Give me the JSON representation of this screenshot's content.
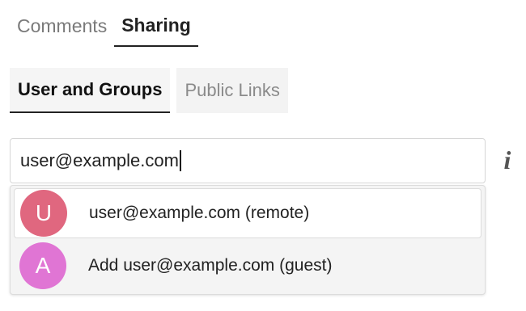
{
  "top_tabs": [
    {
      "label": "Comments"
    },
    {
      "label": "Sharing"
    }
  ],
  "sub_tabs": [
    {
      "label": "User and Groups"
    },
    {
      "label": "Public Links"
    }
  ],
  "search": {
    "value": "user@example.com"
  },
  "info_icon": {
    "glyph": "i",
    "icon": "info-icon"
  },
  "suggestions": [
    {
      "initial": "U",
      "label": "user@example.com (remote)",
      "avatar_color": "#e0677f"
    },
    {
      "initial": "A",
      "label": "Add user@example.com (guest)",
      "avatar_color": "#e075d4"
    }
  ]
}
